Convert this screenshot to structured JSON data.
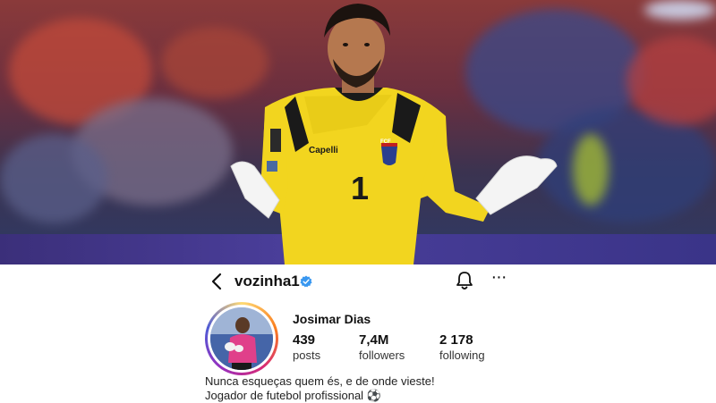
{
  "profile": {
    "username": "vozinha1",
    "display_name": "Josimar Dias",
    "stats": {
      "posts_count": "439",
      "posts_label": "posts",
      "followers_count": "7,4M",
      "followers_label": "followers",
      "following_count": "2 178",
      "following_label": "following"
    },
    "bio": {
      "line1": "Nunca esqueças quem és, e de onde vieste!",
      "line2": "Jogador de futebol profissional ⚽"
    }
  },
  "photo": {
    "shirt_number": "1",
    "sponsor": "Capelli",
    "crest_text": "FCF"
  },
  "colors": {
    "jersey": "#f2d51f",
    "verified": "#3897f0",
    "text": "#111111"
  }
}
